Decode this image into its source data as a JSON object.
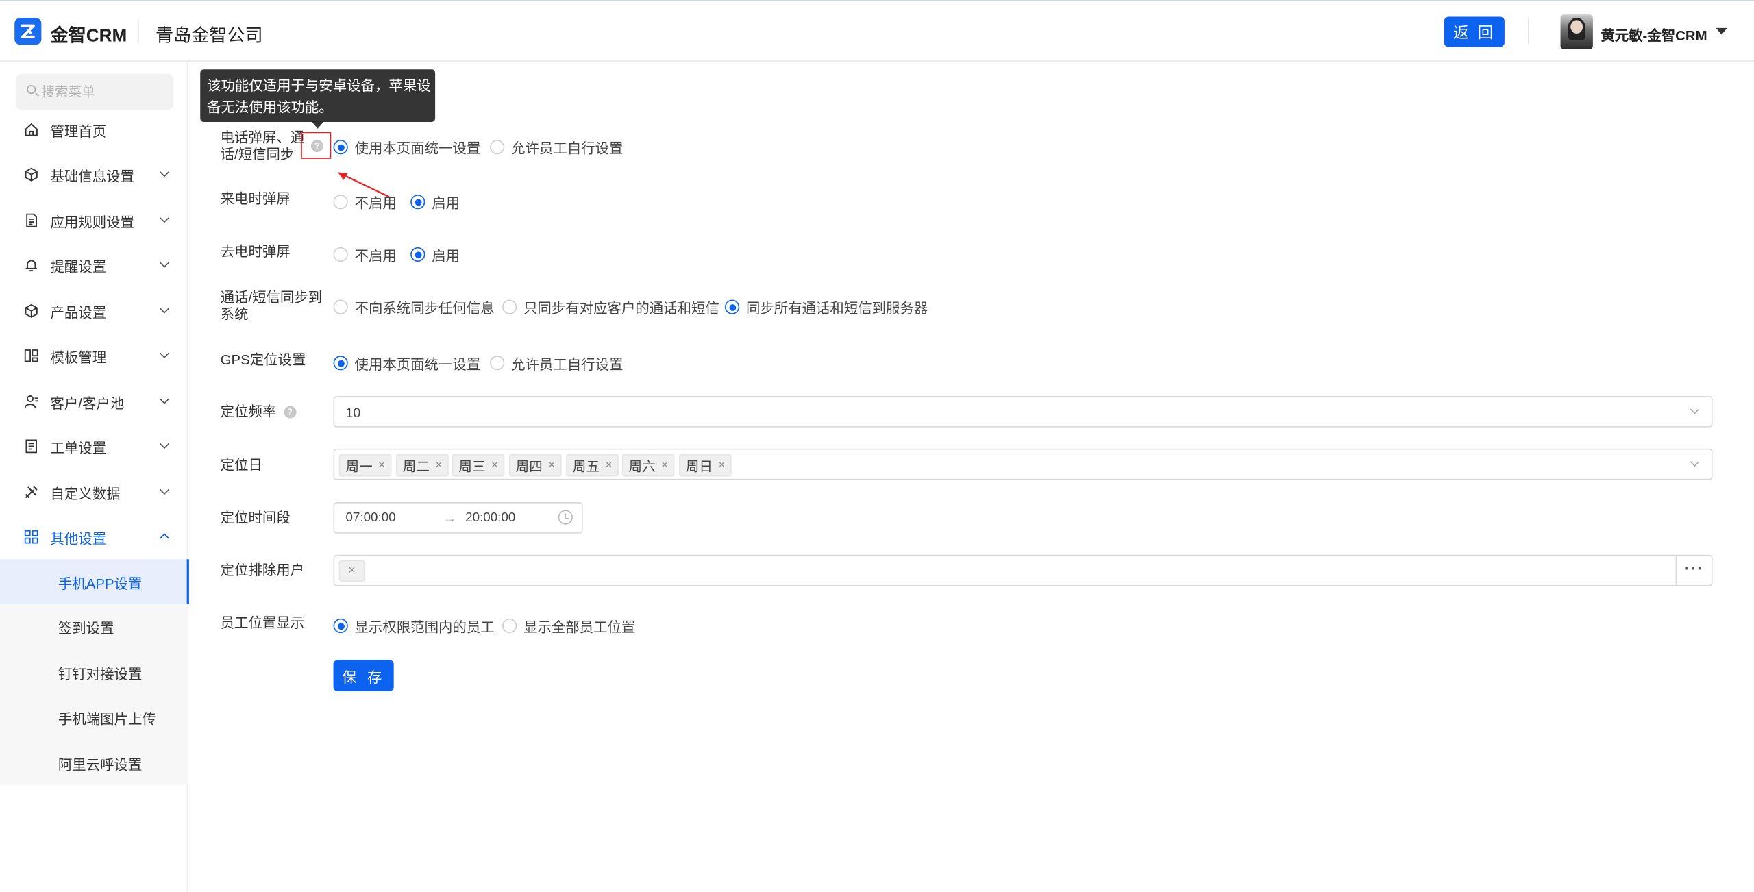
{
  "header": {
    "logo_text": "金智CRM",
    "company": "青岛金智公司",
    "back_label": "返 回",
    "username": "黄元敏-金智CRM"
  },
  "sidebar": {
    "search_placeholder": "搜索菜单",
    "items": [
      {
        "label": "管理首页",
        "icon": "home-icon"
      },
      {
        "label": "基础信息设置",
        "icon": "cube-icon"
      },
      {
        "label": "应用规则设置",
        "icon": "document-icon"
      },
      {
        "label": "提醒设置",
        "icon": "bell-icon"
      },
      {
        "label": "产品设置",
        "icon": "box-icon"
      },
      {
        "label": "模板管理",
        "icon": "template-icon"
      },
      {
        "label": "客户/客户池",
        "icon": "contacts-icon"
      },
      {
        "label": "工单设置",
        "icon": "ticket-icon"
      },
      {
        "label": "自定义数据",
        "icon": "tools-icon"
      },
      {
        "label": "其他设置",
        "icon": "grid-icon"
      }
    ],
    "sub_items": [
      {
        "label": "手机APP设置",
        "active": true
      },
      {
        "label": "签到设置"
      },
      {
        "label": "钉钉对接设置"
      },
      {
        "label": "手机端图片上传"
      },
      {
        "label": "阿里云呼设置"
      }
    ]
  },
  "tooltip": {
    "text_line1": "该功能仅适用于与安卓设备，苹果设",
    "text_line2": "备无法使用该功能。"
  },
  "form": {
    "call_popup_sync": {
      "label_line1": "电话弹屏、通",
      "label_line2": "话/短信同步",
      "options": [
        "使用本页面统一设置",
        "允许员工自行设置"
      ],
      "selected": 0
    },
    "incoming_popup": {
      "label": "来电时弹屏",
      "options": [
        "不启用",
        "启用"
      ],
      "selected": 1
    },
    "outgoing_popup": {
      "label": "去电时弹屏",
      "options": [
        "不启用",
        "启用"
      ],
      "selected": 1
    },
    "sync_to_system": {
      "label_line1": "通话/短信同步到",
      "label_line2": "系统",
      "options": [
        "不向系统同步任何信息",
        "只同步有对应客户的通话和短信",
        "同步所有通话和短信到服务器"
      ],
      "selected": 2
    },
    "gps_setting": {
      "label": "GPS定位设置",
      "options": [
        "使用本页面统一设置",
        "允许员工自行设置"
      ],
      "selected": 0
    },
    "locate_frequency": {
      "label": "定位频率",
      "value": "10"
    },
    "locate_days": {
      "label": "定位日",
      "tags": [
        "周一",
        "周二",
        "周三",
        "周四",
        "周五",
        "周六",
        "周日"
      ]
    },
    "locate_period": {
      "label": "定位时间段",
      "start": "07:00:00",
      "arrow": "→",
      "end": "20:00:00"
    },
    "excluded_users": {
      "label": "定位排除用户",
      "tag_close": "×",
      "more": "···"
    },
    "staff_location": {
      "label": "员工位置显示",
      "options": [
        "显示权限范围内的员工",
        "显示全部员工位置"
      ],
      "selected": 0
    },
    "save_label": "保 存"
  },
  "colors": {
    "primary": "#0b63f0",
    "annotation": "#e52424"
  }
}
